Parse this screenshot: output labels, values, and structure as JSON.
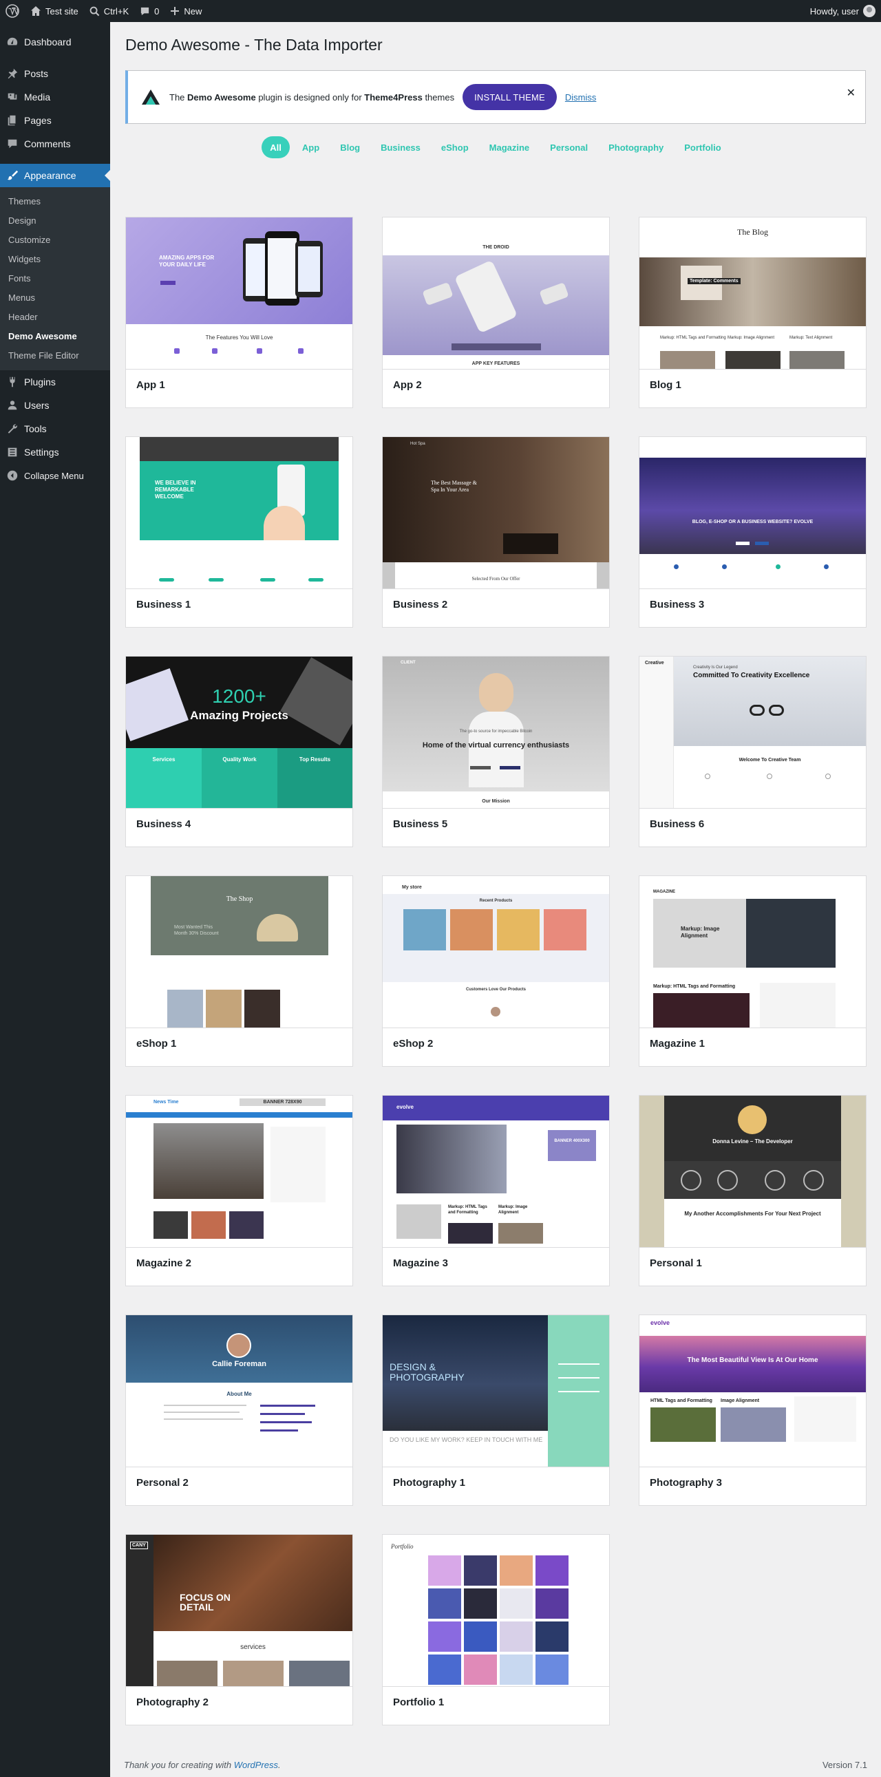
{
  "admin_bar": {
    "site_name": "Test site",
    "search_shortcut": "Ctrl+K",
    "comments_count": "0",
    "new_label": "New",
    "greeting": "Howdy, user"
  },
  "sidebar": {
    "dashboard": "Dashboard",
    "posts": "Posts",
    "media": "Media",
    "pages": "Pages",
    "comments": "Comments",
    "appearance": "Appearance",
    "appearance_sub": [
      "Themes",
      "Design",
      "Customize",
      "Widgets",
      "Fonts",
      "Menus",
      "Header",
      "Demo Awesome",
      "Theme File Editor"
    ],
    "plugins": "Plugins",
    "users": "Users",
    "tools": "Tools",
    "settings": "Settings",
    "collapse": "Collapse Menu"
  },
  "page": {
    "title": "Demo Awesome - The Data Importer"
  },
  "notice": {
    "text_pre": "The ",
    "plugin_name": "Demo Awesome",
    "text_mid": " plugin is designed only for ",
    "theme_vendor": "Theme4Press",
    "text_post": " themes",
    "install_label": "INSTALL THEME",
    "dismiss_label": "Dismiss",
    "close_glyph": "✕"
  },
  "filters": [
    "All",
    "App",
    "Blog",
    "Business",
    "eShop",
    "Magazine",
    "Personal",
    "Photography",
    "Portfolio"
  ],
  "demos": [
    "App 1",
    "App 2",
    "Blog 1",
    "Business 1",
    "Business 2",
    "Business 3",
    "Business 4",
    "Business 5",
    "Business 6",
    "eShop 1",
    "eShop 2",
    "Magazine 1",
    "Magazine 2",
    "Magazine 3",
    "Personal 1",
    "Personal 2",
    "Photography 1",
    "Photography 3",
    "Photography 2",
    "Portfolio 1"
  ],
  "thumb_text": {
    "app1_headline": "AMAZING APPS FOR YOUR DAILY LIFE",
    "app1_features": "The Features You Will Love",
    "app2_brand": "THE DROID",
    "app2_features": "APP KEY FEATURES",
    "blog1_title": "The Blog",
    "blog1_caption": "Template: Comments",
    "blog1_posts": [
      "Markup: HTML Tags and Formatting",
      "Markup: Image Alignment",
      "Markup: Text Alignment"
    ],
    "bus1_headline": "WE BELIEVE IN REMARKABLE WELCOME",
    "bus2_badge": "Hot Spa",
    "bus2_headline": "The Best Massage & Spa In Your Area",
    "bus2_section": "Selected From Our Offer",
    "bus3_headline": "BLOG, E-SHOP OR A BUSINESS WEBSITE? EVOLVE",
    "bus4_number": "1200+",
    "bus4_sub": "Amazing Projects",
    "bus4_cols": [
      "Services",
      "Quality Work",
      "Top Results"
    ],
    "bus5_brand": "CLIENT",
    "bus5_quote": "The go-to source for impeccable Bitcoin",
    "bus5_headline": "Home of the virtual currency enthusiasts",
    "bus5_section": "Our Mission",
    "bus6_brand": "Creative",
    "bus6_small": "Creativity Is Our Legend",
    "bus6_headline": "Committed To Creativity Excellence",
    "bus6_section": "Welcome To Creative Team",
    "eshop1_title": "The Shop",
    "eshop1_text": "Most Wanted This Month 30% Discount",
    "eshop2_brand": "My store",
    "eshop2_section": "Recent Products",
    "eshop2_reviews": "Customers Love Our Products",
    "mag1_brand": "MAGAZINE",
    "mag1_feature": "Markup: Image Alignment",
    "mag1_post": "Markup: HTML Tags and Formatting",
    "mag2_brand": "News Time",
    "mag2_banner": "BANNER 728X90",
    "mag3_brand": "evolve",
    "mag3_banner": "BANNER 400X300",
    "mag3_posts": [
      "Markup: HTML Tags and Formatting",
      "Markup: Image Alignment"
    ],
    "pers1_name": "Donna Levine – The Developer",
    "pers1_headline": "My Another Accomplishments For Your Next Project",
    "pers2_name": "Callie Foreman",
    "pers2_section": "About Me",
    "photo1_headline": "DESIGN & PHOTOGRAPHY",
    "photo1_sub": "DO YOU LIKE MY WORK? KEEP IN TOUCH WITH ME",
    "photo3_brand": "evolve",
    "photo3_headline": "The Most Beautiful View Is At Our Home",
    "photo3_posts": [
      "HTML Tags and Formatting",
      "Image Alignment"
    ],
    "photo2_brand": "CANY",
    "photo2_headline": "FOCUS ON DETAIL",
    "photo2_section": "services",
    "port1_brand": "Portfolio"
  },
  "footer": {
    "thanks_pre": "Thank you for creating with ",
    "wp_link": "WordPress",
    "thanks_post": ".",
    "version": "Version 7.1"
  },
  "colors": {
    "admin_dark": "#1d2327",
    "wp_blue": "#2271b1",
    "filter_teal": "#38d0bb",
    "install_purple": "#4433a6"
  }
}
